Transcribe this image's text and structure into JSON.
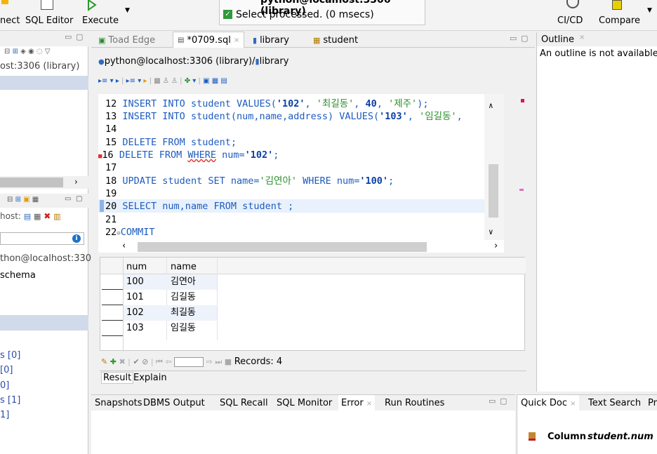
{
  "toolbar": {
    "connect": "nect",
    "sql_editor": "SQL Editor",
    "execute": "Execute",
    "cicd": "CI/CD",
    "compare": "Compare"
  },
  "status_popup": {
    "title": "python@localhost:3306 (library)",
    "message": "Select processed. (0 msecs)"
  },
  "left_panel": {
    "connection": "ost:3306 (library)",
    "conn_prefix": "host:",
    "tree_item1": "thon@localhost:330",
    "tree_item2": "schema",
    "counts": [
      "s [0]",
      "[0]",
      "0]",
      "s [1]",
      "1]"
    ]
  },
  "editor_tabs": [
    {
      "label": "Toad Edge"
    },
    {
      "label": "*0709.sql"
    },
    {
      "label": "library"
    },
    {
      "label": "student"
    }
  ],
  "breadcrumb": {
    "connection": "python@localhost:3306 (library)/",
    "schema": "library"
  },
  "code": {
    "l12": {
      "num": "12",
      "pre": "INSERT INTO student VALUES(",
      "s1": "'102'",
      "c1": ", ",
      "s2": "'최길동'",
      "c2": ", ",
      "n1": "40",
      "c3": ", ",
      "s3": "'제주'",
      "post": ");"
    },
    "l13": {
      "num": "13",
      "pre": "INSERT INTO student(num,name,address) VALUES(",
      "s1": "'103'",
      "c1": ", ",
      "s2": "'임길동'",
      "post": ","
    },
    "l14": {
      "num": "14"
    },
    "l15": {
      "num": "15",
      "text": "DELETE FROM student;"
    },
    "l16": {
      "num": "16",
      "pre": "DELETE FROM ",
      "err": "WHERE",
      "mid": " num=",
      "s1": "'102'",
      "post": ";"
    },
    "l17": {
      "num": "17"
    },
    "l18": {
      "num": "18",
      "pre": "UPDATE student SET name=",
      "s1": "'김연아'",
      "mid": " WHERE num=",
      "s2": "'100'",
      "post": ";"
    },
    "l19": {
      "num": "19"
    },
    "l20": {
      "num": "20",
      "text": "SELECT num,name FROM student ;"
    },
    "l21": {
      "num": "21"
    },
    "l22": {
      "num": "22",
      "text": "COMMIT"
    }
  },
  "results": {
    "columns": [
      "num",
      "name"
    ],
    "rows": [
      [
        "100",
        "김연아"
      ],
      [
        "101",
        "김길동"
      ],
      [
        "102",
        "최길동"
      ],
      [
        "103",
        "임길동"
      ]
    ],
    "records": "Records: 4",
    "tab_result": "Result",
    "tab_explain": "Explain"
  },
  "outline": {
    "title": "Outline",
    "message": "An outline is not available."
  },
  "bottom_tabs": [
    "Snapshots",
    "DBMS Output",
    "SQL Recall",
    "SQL Monitor",
    "Error",
    "Run Routines"
  ],
  "quick_doc": {
    "tab1": "Quick Doc",
    "tab2": "Text Search",
    "tab3": "Pr",
    "column_label": "Column",
    "column_name": "student.num"
  },
  "colors": {
    "keyword": "#1d5cbf",
    "string": "#2a8f2a",
    "selection": "#dfe9f8",
    "header_blue": "#d4deef"
  }
}
